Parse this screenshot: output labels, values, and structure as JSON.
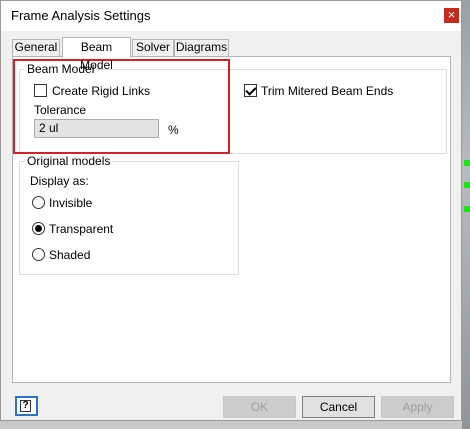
{
  "window": {
    "title": "Frame Analysis Settings",
    "close_glyph": "×"
  },
  "tabs": [
    {
      "label": "General",
      "active": false
    },
    {
      "label": "Beam Model",
      "active": true
    },
    {
      "label": "Solver",
      "active": false
    },
    {
      "label": "Diagrams",
      "active": false
    }
  ],
  "beam_model": {
    "group_label": "Beam Model",
    "create_rigid_links": {
      "label": "Create Rigid Links",
      "checked": false
    },
    "trim_mitered": {
      "label": "Trim Mitered Beam Ends",
      "checked": true
    },
    "tolerance_label": "Tolerance",
    "tolerance_value": "2 ul",
    "tolerance_unit": "%"
  },
  "original_models": {
    "group_label": "Original models",
    "display_as_label": "Display as:",
    "options": [
      {
        "label": "Invisible",
        "checked": false
      },
      {
        "label": "Transparent",
        "checked": true
      },
      {
        "label": "Shaded",
        "checked": false
      }
    ]
  },
  "buttons": {
    "ok": "OK",
    "cancel": "Cancel",
    "apply": "Apply",
    "help_glyph": "?"
  },
  "colors": {
    "highlight": "#d4202c",
    "focus": "#2a73c9",
    "close": "#c42b1c"
  }
}
